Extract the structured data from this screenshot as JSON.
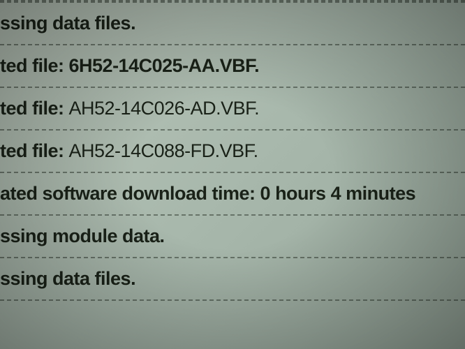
{
  "log": {
    "lines": [
      {
        "prefix": "ssing data files.",
        "value": "",
        "bold": true
      },
      {
        "prefix": "ted file: ",
        "value": "6H52-14C025-AA.VBF.",
        "bold": true
      },
      {
        "prefix": "ted file: ",
        "value": "AH52-14C026-AD.VBF.",
        "bold": false
      },
      {
        "prefix": "ted file: ",
        "value": "AH52-14C088-FD.VBF.",
        "bold": false
      },
      {
        "prefix": "ated software download time: ",
        "value": "0 hours 4 minutes",
        "bold": true
      },
      {
        "prefix": "ssing module data.",
        "value": "",
        "bold": true
      },
      {
        "prefix": "ssing data files.",
        "value": "",
        "bold": true
      }
    ]
  }
}
